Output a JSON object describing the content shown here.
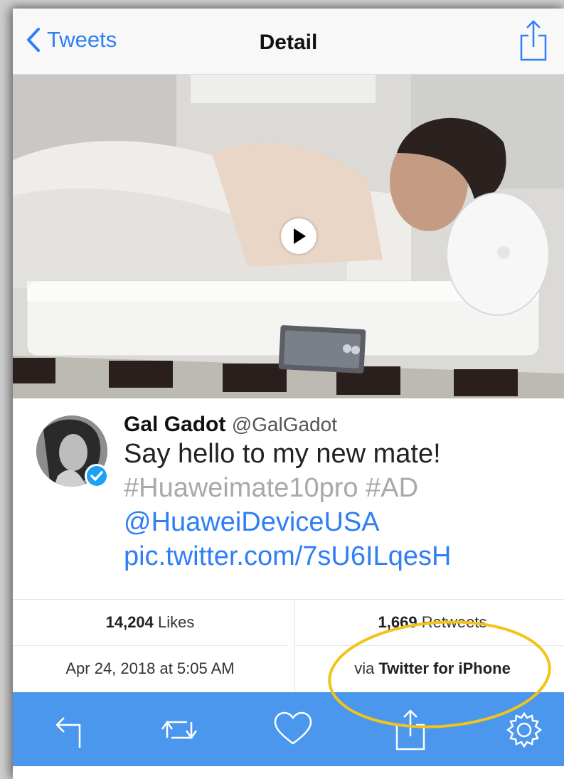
{
  "navbar": {
    "back_label": "Tweets",
    "title": "Detail",
    "share_icon": "share-icon"
  },
  "media": {
    "description_icon": "play-icon"
  },
  "tweet": {
    "name": "Gal Gadot",
    "handle": "@GalGadot",
    "text_line1": "Say hello to my new mate!",
    "hashtags": "#Huaweimate10pro #AD",
    "mention": "@HuaweiDeviceUSA",
    "link": "pic.twitter.com/7sU6ILqesH"
  },
  "stats": {
    "likes_count": "14,204",
    "likes_label": "Likes",
    "retweets_count": "1,669",
    "retweets_label": "Retweets",
    "date": "Apr 24, 2018 at 5:05 AM",
    "via_prefix": "via",
    "via_client": "Twitter for iPhone"
  },
  "toolbar": {
    "icons": [
      "reply-icon",
      "retweet-icon",
      "like-icon",
      "share-icon",
      "settings-icon"
    ]
  },
  "colors": {
    "accent": "#2f7ef5",
    "toolbar": "#4b97ee",
    "annotation_circle": "#f0c419"
  }
}
